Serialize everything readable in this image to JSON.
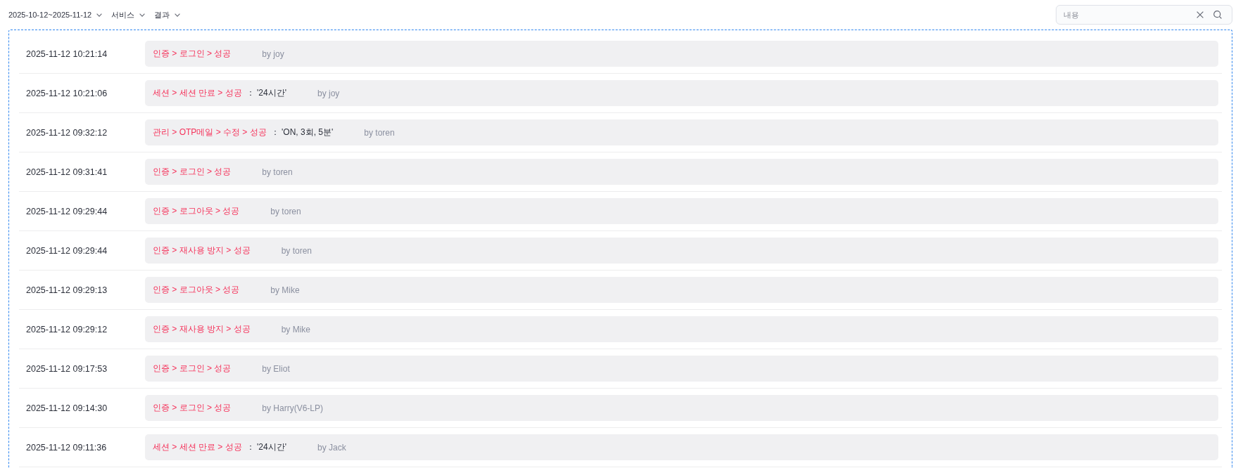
{
  "toolbar": {
    "filters": [
      {
        "label": "2025-10-12~2025-11-12"
      },
      {
        "label": "서비스"
      },
      {
        "label": "결과"
      }
    ],
    "search": {
      "placeholder": "내용"
    }
  },
  "log": [
    {
      "time": "2025-11-12 10:21:14",
      "action": "인증 > 로그인 > 성공",
      "user": "by joy"
    },
    {
      "time": "2025-11-12 10:21:06",
      "action": "세션 > 세션 만료 > 성공",
      "detail": "： '24시간'",
      "user": "by joy"
    },
    {
      "time": "2025-11-12 09:32:12",
      "action": "관리 > OTP메일 > 수정 > 성공",
      "detail": "： 'ON, 3회, 5분'",
      "user": "by toren"
    },
    {
      "time": "2025-11-12 09:31:41",
      "action": "인증 > 로그인 > 성공",
      "user": "by toren"
    },
    {
      "time": "2025-11-12 09:29:44",
      "action": "인증 > 로그아웃 > 성공",
      "user": "by toren"
    },
    {
      "time": "2025-11-12 09:29:44",
      "action": "인증 > 재사용 방지 > 성공",
      "user": "by toren"
    },
    {
      "time": "2025-11-12 09:29:13",
      "action": "인증 > 로그아웃 > 성공",
      "user": "by Mike"
    },
    {
      "time": "2025-11-12 09:29:12",
      "action": "인증 > 재사용 방지 > 성공",
      "user": "by Mike"
    },
    {
      "time": "2025-11-12 09:17:53",
      "action": "인증 > 로그인 > 성공",
      "user": "by Eliot"
    },
    {
      "time": "2025-11-12 09:14:30",
      "action": "인증 > 로그인 > 성공",
      "user": "by Harry(V6-LP)"
    },
    {
      "time": "2025-11-12 09:11:36",
      "action": "세션 > 세션 만료 > 성공",
      "detail": "： '24시간'",
      "user": "by Jack"
    }
  ]
}
